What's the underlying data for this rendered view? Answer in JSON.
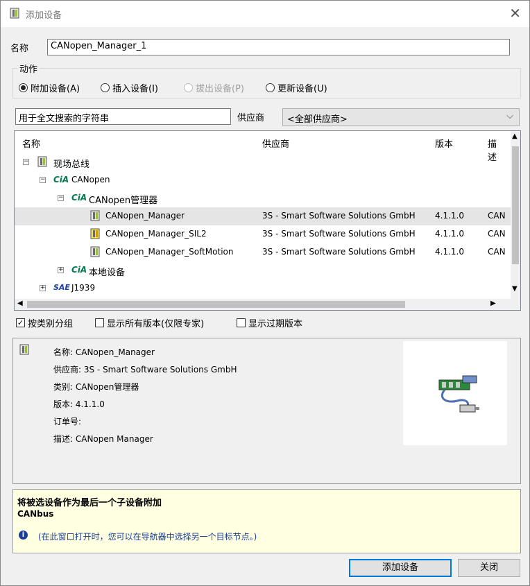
{
  "window": {
    "title": "添加设备",
    "close_glyph": "✕"
  },
  "name_field": {
    "label": "名称",
    "value": "CANopen_Manager_1"
  },
  "action_group": {
    "title": "动作",
    "options": [
      {
        "label": "附加设备(A)",
        "selected": true,
        "enabled": true
      },
      {
        "label": "插入设备(I)",
        "selected": false,
        "enabled": true
      },
      {
        "label": "拔出设备(P)",
        "selected": false,
        "enabled": false
      },
      {
        "label": "更新设备(U)",
        "selected": false,
        "enabled": true
      }
    ]
  },
  "search": {
    "placeholder": "用于全文搜索的字符串"
  },
  "vendor": {
    "label": "供应商",
    "selected": "<全部供应商>"
  },
  "tree": {
    "columns": {
      "name": "名称",
      "vendor": "供应商",
      "version": "版本",
      "desc": "描述"
    },
    "nodes": {
      "fieldbus": "现场总线",
      "canopen": "CANopen",
      "cia": "CiA",
      "manager_group": "CANopen管理器",
      "local_devices": "本地设备",
      "sae": "SAE",
      "j1939": "J1939"
    },
    "devices": [
      {
        "name": "CANopen_Manager",
        "vendor": "3S - Smart Software Solutions GmbH",
        "version": "4.1.1.0",
        "desc": "CAN"
      },
      {
        "name": "CANopen_Manager_SIL2",
        "vendor": "3S - Smart Software Solutions GmbH",
        "version": "4.1.1.0",
        "desc": "CAN"
      },
      {
        "name": "CANopen_Manager_SoftMotion",
        "vendor": "3S - Smart Software Solutions GmbH",
        "version": "4.1.1.0",
        "desc": "CAN"
      }
    ]
  },
  "options": {
    "group_by_category": "按类别分组",
    "show_all_versions": "显示所有版本(仅限专家)",
    "show_outdated": "显示过期版本"
  },
  "details": {
    "name": "名称: CANopen_Manager",
    "vendor": "供应商: 3S - Smart Software Solutions GmbH",
    "category": "类别: CANopen管理器",
    "version": "版本: 4.1.1.0",
    "order": "订单号:",
    "description": "描述: CANopen Manager"
  },
  "hint": {
    "title": "将被选设备作为最后一个子设备附加",
    "subtitle": "CANbus",
    "note": "(在此窗口打开时，您可以在导航器中选择另一个目标节点。)"
  },
  "buttons": {
    "add": "添加设备",
    "close": "关闭"
  },
  "colors": {
    "accent": "#0078d7",
    "hint_bg": "#ffffe1",
    "cia_green": "#007a4d"
  }
}
